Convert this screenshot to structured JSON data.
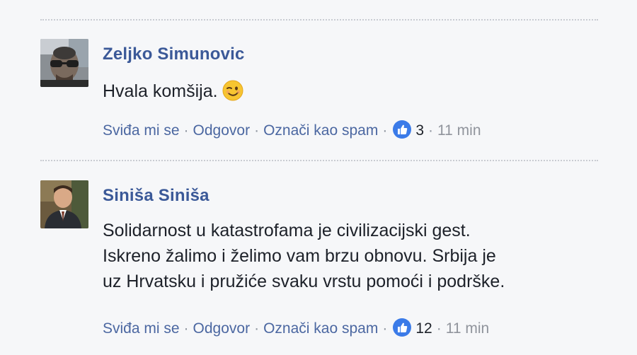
{
  "comments": [
    {
      "author": "Zeljko Simunovic",
      "text": "Hvala komšija.",
      "actions": {
        "like": "Sviđa mi se",
        "reply": "Odgovor",
        "spam": "Označi kao spam"
      },
      "likes": "3",
      "time": "11 min"
    },
    {
      "author": "Siniša Siniša",
      "text_lines": [
        "Solidarnost u katastrofama je civilizacijski gest.",
        "Iskreno žalimo i želimo vam brzu obnovu. Srbija je",
        "uz Hrvatsku i pružiće svaku vrstu pomoći i podrške."
      ],
      "actions": {
        "like": "Sviđa mi se",
        "reply": "Odgovor",
        "spam": "Označi kao spam"
      },
      "likes": "12",
      "time": "11 min"
    }
  ],
  "separator": "·",
  "colors": {
    "link": "#4b67a1",
    "author": "#3b5998",
    "text": "#1d2129",
    "meta": "#90949c",
    "like_badge": "#3b7be8"
  },
  "icons": {
    "emoji": "winking-face-icon",
    "like": "thumbs-up-icon"
  }
}
